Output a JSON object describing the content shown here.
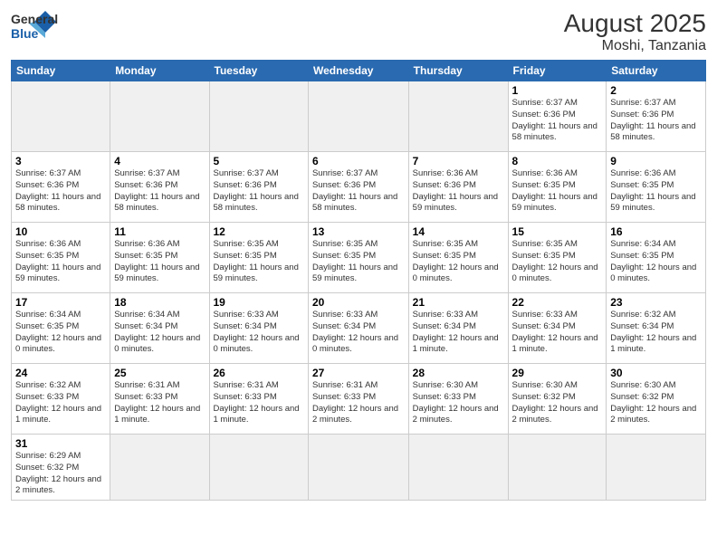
{
  "header": {
    "logo_general": "General",
    "logo_blue": "Blue",
    "month_year": "August 2025",
    "location": "Moshi, Tanzania"
  },
  "days_of_week": [
    "Sunday",
    "Monday",
    "Tuesday",
    "Wednesday",
    "Thursday",
    "Friday",
    "Saturday"
  ],
  "weeks": [
    [
      {
        "day": "",
        "empty": true
      },
      {
        "day": "",
        "empty": true
      },
      {
        "day": "",
        "empty": true
      },
      {
        "day": "",
        "empty": true
      },
      {
        "day": "",
        "empty": true
      },
      {
        "day": "1",
        "sunrise": "6:37 AM",
        "sunset": "6:36 PM",
        "daylight": "11 hours and 58 minutes."
      },
      {
        "day": "2",
        "sunrise": "6:37 AM",
        "sunset": "6:36 PM",
        "daylight": "11 hours and 58 minutes."
      }
    ],
    [
      {
        "day": "3",
        "sunrise": "6:37 AM",
        "sunset": "6:36 PM",
        "daylight": "11 hours and 58 minutes."
      },
      {
        "day": "4",
        "sunrise": "6:37 AM",
        "sunset": "6:36 PM",
        "daylight": "11 hours and 58 minutes."
      },
      {
        "day": "5",
        "sunrise": "6:37 AM",
        "sunset": "6:36 PM",
        "daylight": "11 hours and 58 minutes."
      },
      {
        "day": "6",
        "sunrise": "6:37 AM",
        "sunset": "6:36 PM",
        "daylight": "11 hours and 58 minutes."
      },
      {
        "day": "7",
        "sunrise": "6:36 AM",
        "sunset": "6:36 PM",
        "daylight": "11 hours and 59 minutes."
      },
      {
        "day": "8",
        "sunrise": "6:36 AM",
        "sunset": "6:35 PM",
        "daylight": "11 hours and 59 minutes."
      },
      {
        "day": "9",
        "sunrise": "6:36 AM",
        "sunset": "6:35 PM",
        "daylight": "11 hours and 59 minutes."
      }
    ],
    [
      {
        "day": "10",
        "sunrise": "6:36 AM",
        "sunset": "6:35 PM",
        "daylight": "11 hours and 59 minutes."
      },
      {
        "day": "11",
        "sunrise": "6:36 AM",
        "sunset": "6:35 PM",
        "daylight": "11 hours and 59 minutes."
      },
      {
        "day": "12",
        "sunrise": "6:35 AM",
        "sunset": "6:35 PM",
        "daylight": "11 hours and 59 minutes."
      },
      {
        "day": "13",
        "sunrise": "6:35 AM",
        "sunset": "6:35 PM",
        "daylight": "11 hours and 59 minutes."
      },
      {
        "day": "14",
        "sunrise": "6:35 AM",
        "sunset": "6:35 PM",
        "daylight": "12 hours and 0 minutes."
      },
      {
        "day": "15",
        "sunrise": "6:35 AM",
        "sunset": "6:35 PM",
        "daylight": "12 hours and 0 minutes."
      },
      {
        "day": "16",
        "sunrise": "6:34 AM",
        "sunset": "6:35 PM",
        "daylight": "12 hours and 0 minutes."
      }
    ],
    [
      {
        "day": "17",
        "sunrise": "6:34 AM",
        "sunset": "6:35 PM",
        "daylight": "12 hours and 0 minutes."
      },
      {
        "day": "18",
        "sunrise": "6:34 AM",
        "sunset": "6:34 PM",
        "daylight": "12 hours and 0 minutes."
      },
      {
        "day": "19",
        "sunrise": "6:33 AM",
        "sunset": "6:34 PM",
        "daylight": "12 hours and 0 minutes."
      },
      {
        "day": "20",
        "sunrise": "6:33 AM",
        "sunset": "6:34 PM",
        "daylight": "12 hours and 0 minutes."
      },
      {
        "day": "21",
        "sunrise": "6:33 AM",
        "sunset": "6:34 PM",
        "daylight": "12 hours and 1 minute."
      },
      {
        "day": "22",
        "sunrise": "6:33 AM",
        "sunset": "6:34 PM",
        "daylight": "12 hours and 1 minute."
      },
      {
        "day": "23",
        "sunrise": "6:32 AM",
        "sunset": "6:34 PM",
        "daylight": "12 hours and 1 minute."
      }
    ],
    [
      {
        "day": "24",
        "sunrise": "6:32 AM",
        "sunset": "6:33 PM",
        "daylight": "12 hours and 1 minute."
      },
      {
        "day": "25",
        "sunrise": "6:31 AM",
        "sunset": "6:33 PM",
        "daylight": "12 hours and 1 minute."
      },
      {
        "day": "26",
        "sunrise": "6:31 AM",
        "sunset": "6:33 PM",
        "daylight": "12 hours and 1 minute."
      },
      {
        "day": "27",
        "sunrise": "6:31 AM",
        "sunset": "6:33 PM",
        "daylight": "12 hours and 2 minutes."
      },
      {
        "day": "28",
        "sunrise": "6:30 AM",
        "sunset": "6:33 PM",
        "daylight": "12 hours and 2 minutes."
      },
      {
        "day": "29",
        "sunrise": "6:30 AM",
        "sunset": "6:32 PM",
        "daylight": "12 hours and 2 minutes."
      },
      {
        "day": "30",
        "sunrise": "6:30 AM",
        "sunset": "6:32 PM",
        "daylight": "12 hours and 2 minutes."
      }
    ],
    [
      {
        "day": "31",
        "sunrise": "6:29 AM",
        "sunset": "6:32 PM",
        "daylight": "12 hours and 2 minutes."
      },
      {
        "day": "",
        "empty": true
      },
      {
        "day": "",
        "empty": true
      },
      {
        "day": "",
        "empty": true
      },
      {
        "day": "",
        "empty": true
      },
      {
        "day": "",
        "empty": true
      },
      {
        "day": "",
        "empty": true
      }
    ]
  ]
}
